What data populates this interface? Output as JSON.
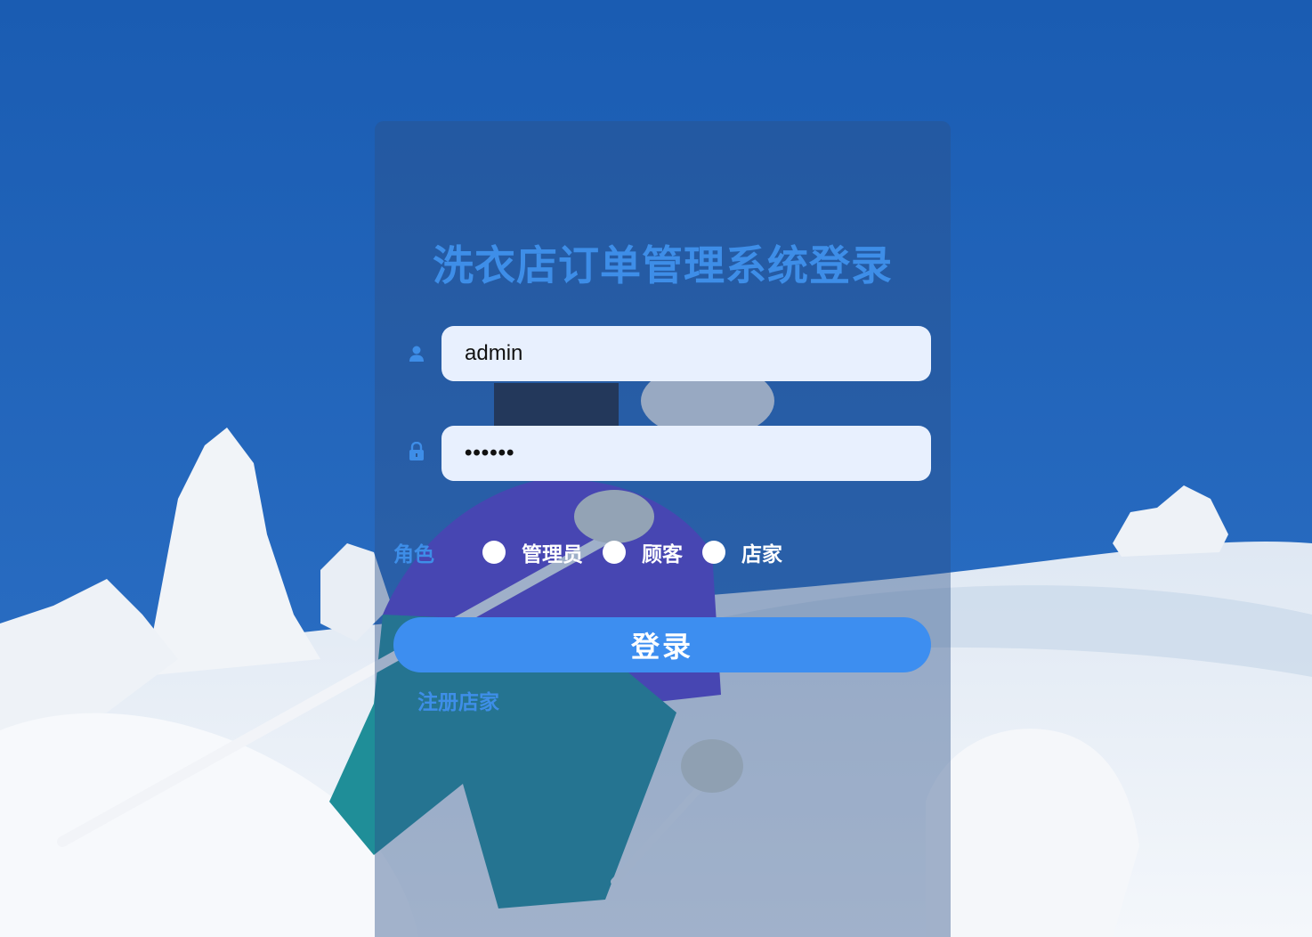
{
  "login": {
    "title": "洗衣店订单管理系统登录",
    "username": {
      "value": "admin",
      "icon": "user-icon"
    },
    "password": {
      "value": "123456",
      "icon": "lock-icon"
    },
    "role": {
      "label": "角色",
      "options": [
        "管理员",
        "顾客",
        "店家"
      ]
    },
    "submit_label": "登录",
    "register_link": "注册店家"
  },
  "colors": {
    "accent": "#3e8ee8",
    "button": "#3d8ef0",
    "input_bg": "#e8f0fe"
  }
}
